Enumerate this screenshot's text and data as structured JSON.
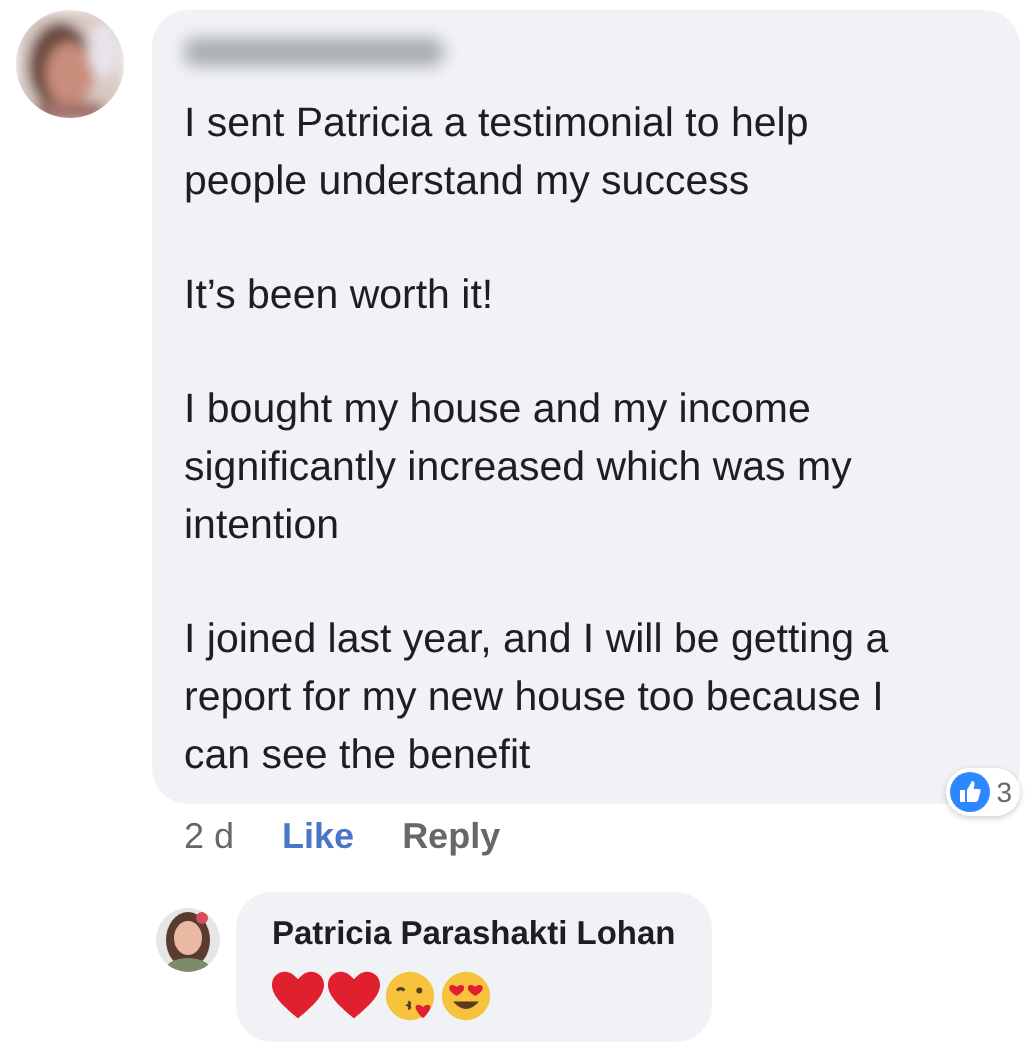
{
  "comment": {
    "paragraphs": [
      {
        "lines": [
          "I sent Patricia a testimonial to help",
          "people understand my success"
        ]
      },
      {
        "lines": [
          "It’s been worth it!"
        ]
      },
      {
        "lines": [
          "I bought my house and my income",
          "significantly increased which was my",
          "intention"
        ]
      },
      {
        "lines": [
          "I joined last year, and I will be getting a",
          "report for my new house too because I",
          "can see the benefit"
        ]
      }
    ],
    "time": "2 d",
    "like": {
      "label": "Like",
      "liked": true
    },
    "reply": "Reply",
    "reaction_count": "3"
  },
  "reply": {
    "author": "Patricia Parashakti Lohan",
    "emojis": [
      {
        "kind": "heart"
      },
      {
        "kind": "heart"
      },
      {
        "kind": "kiss"
      },
      {
        "kind": "heart-eyes"
      }
    ]
  }
}
